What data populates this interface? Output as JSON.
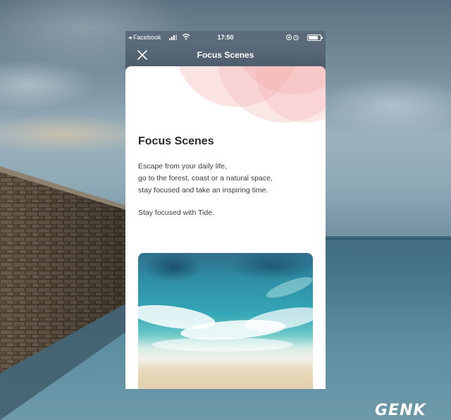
{
  "status_bar": {
    "back_app": "◂ Facebook",
    "time": "17:50"
  },
  "nav": {
    "title": "Focus Scenes"
  },
  "content": {
    "heading": "Focus Scenes",
    "body_lines": [
      "Escape from your daily life,",
      "go to the forest, coast or a natural space,",
      "stay focused and take an inspiring time."
    ],
    "tagline": "Stay focused with Tide."
  },
  "icons": {
    "close": "close-icon",
    "wifi": "wifi-icon",
    "battery": "battery-icon",
    "signal": "signal-icon",
    "alarm": "alarm-icon",
    "rotation_lock": "rotation-lock-icon"
  },
  "colors": {
    "nav_bg": "#5b6b7b",
    "accent_circles": "#f4b0b0",
    "text_primary": "#2b2b2b"
  },
  "watermark": {
    "text": "GENK"
  }
}
